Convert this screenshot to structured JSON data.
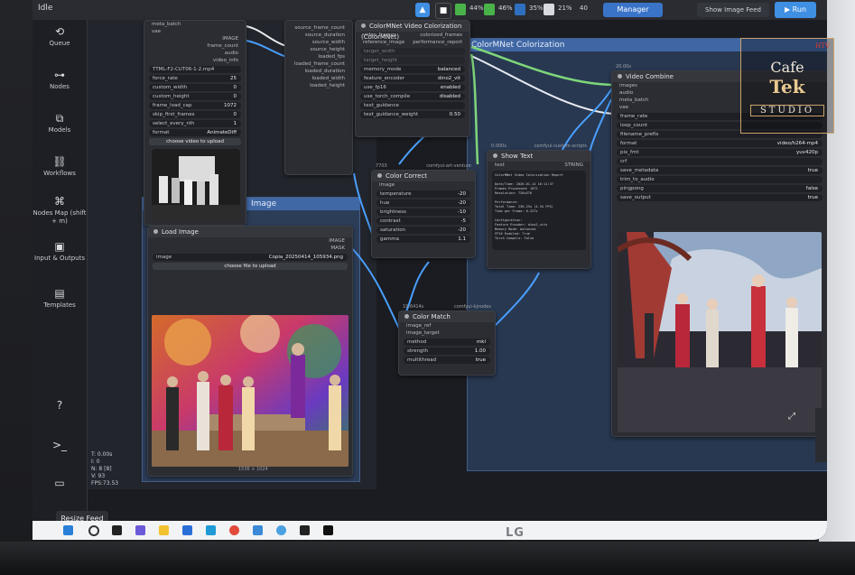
{
  "topbar": {
    "app_name": "Idle",
    "stats": [
      "44%",
      "46%",
      "35%",
      "21%",
      "40"
    ],
    "manager_label": "Manager",
    "feed_label": "Show Image Feed",
    "run_label": "Run"
  },
  "sidebar": {
    "items": [
      {
        "label": "Queue",
        "icon": "history-icon"
      },
      {
        "label": "Nodes",
        "icon": "nodes-icon"
      },
      {
        "label": "Models",
        "icon": "cube-icon"
      },
      {
        "label": "Workflows",
        "icon": "workflow-icon"
      },
      {
        "label": "Nodes Map (shift + m)",
        "icon": "map-icon"
      },
      {
        "label": "Input & Outputs",
        "icon": "image-icon"
      },
      {
        "label": "Templates",
        "icon": "template-icon"
      }
    ],
    "bottom_icons": [
      "help-icon",
      "terminal-icon",
      "keyboard-icon"
    ]
  },
  "groups": {
    "colorization": "ColorMNet Colorization",
    "image": "Image"
  },
  "nodes": {
    "video_loader": {
      "outputs": [
        "meta_batch",
        "vae"
      ],
      "outputs_right": [
        "IMAGE",
        "frame_count",
        "audio",
        "video_info"
      ],
      "widgets": [
        {
          "name": "TTML-F2-CUT06-1-2.mp4",
          "value": ""
        },
        {
          "name": "force_rate",
          "value": "25"
        },
        {
          "name": "custom_width",
          "value": "0"
        },
        {
          "name": "custom_height",
          "value": "0"
        },
        {
          "name": "frame_load_cap",
          "value": "1072"
        },
        {
          "name": "skip_first_frames",
          "value": "0"
        },
        {
          "name": "select_every_nth",
          "value": "1"
        },
        {
          "name": "format",
          "value": "AnimateDiff"
        }
      ],
      "upload_label": "choose video to upload"
    },
    "video_info": {
      "outputs": [
        "source_frame_count",
        "source_duration",
        "source_width",
        "source_height",
        "loaded_fps",
        "loaded_frame_count",
        "loaded_duration",
        "loaded_width",
        "loaded_height"
      ]
    },
    "colormnet": {
      "title": "ColorMNet Video Colorization (ColorMNet)",
      "inputs": [
        "video_frames",
        "reference_image"
      ],
      "outputs": [
        "colorized_frames",
        "performance_report"
      ],
      "widgets": [
        {
          "name": "target_width",
          "value": ""
        },
        {
          "name": "target_height",
          "value": ""
        },
        {
          "name": "memory_mode",
          "value": "balanced"
        },
        {
          "name": "feature_encoder",
          "value": "dino2_vit"
        },
        {
          "name": "use_fp16",
          "value": "enabled"
        },
        {
          "name": "use_torch_compile",
          "value": "disabled"
        },
        {
          "name": "text_guidance",
          "value": ""
        },
        {
          "name": "text_guidance_weight",
          "value": "0.50"
        }
      ]
    },
    "color_correct": {
      "id": "7703",
      "title": "Color Correct",
      "badge": "comfyui-art-venture",
      "inputs": [
        "image"
      ],
      "widgets": [
        {
          "name": "temperature",
          "value": "-20"
        },
        {
          "name": "hue",
          "value": "-20"
        },
        {
          "name": "brightness",
          "value": "-10"
        },
        {
          "name": "contrast",
          "value": "-5"
        },
        {
          "name": "saturation",
          "value": "-20"
        },
        {
          "name": "gamma",
          "value": "1.1"
        }
      ]
    },
    "color_match": {
      "id": "19.6414s",
      "title": "Color Match",
      "badge": "comfyui-kjnodes",
      "inputs": [
        "image_ref",
        "image_target"
      ],
      "widgets": [
        {
          "name": "method",
          "value": "mkl"
        },
        {
          "name": "strength",
          "value": "1.00"
        },
        {
          "name": "multithread",
          "value": "true"
        }
      ]
    },
    "show_text": {
      "id": "0.000s",
      "title": "Show Text",
      "badge": "comfyui-custom-scripts",
      "inputs": [
        "text"
      ],
      "outputs": [
        "STRING"
      ],
      "report": [
        "ColorMNet Video Colorization Report",
        "",
        "Date/Time: 2026-01-14 16:11:37",
        "Frames Processed: 1072",
        "Resolution: 720x576",
        "",
        "Performance:",
        "  Total Time: 236.23s (4.34 FPS)",
        "  Time per Frame: 0.227s",
        "",
        "Configuration:",
        "  Feature Encoder: dino2_vits",
        "  Memory Mode: balanced",
        "  FP16 Enabled: True",
        "  Torch Compile: False"
      ]
    },
    "video_combine": {
      "id": "20.00s",
      "title": "Video Combine",
      "inputs": [
        "images",
        "audio",
        "meta_batch",
        "vae"
      ],
      "widgets": [
        {
          "name": "frame_rate",
          "value": ""
        },
        {
          "name": "loop_count",
          "value": ""
        },
        {
          "name": "filename_prefix",
          "value": ""
        },
        {
          "name": "format",
          "value": "video/h264-mp4"
        },
        {
          "name": "pix_fmt",
          "value": "yuv420p"
        },
        {
          "name": "crf",
          "value": ""
        },
        {
          "name": "save_metadata",
          "value": "true"
        },
        {
          "name": "trim_to_audio",
          "value": ""
        },
        {
          "name": "pingpong",
          "value": "false"
        },
        {
          "name": "save_output",
          "value": "true"
        }
      ]
    },
    "load_image": {
      "title": "Load Image",
      "outputs": [
        "IMAGE",
        "MASK"
      ],
      "widgets": [
        {
          "name": "image",
          "value": "Copia_20250414_105934.png"
        }
      ],
      "upload_label": "choose file to upload",
      "dimensions": "1536 × 1024"
    }
  },
  "canvas_info": [
    "T: 0.00s",
    "I: 0",
    "N: 8 [8]",
    "V: 93",
    "FPS:73.53"
  ],
  "resize_feed_label": "Resize Feed",
  "logo": {
    "line1": "Cafe",
    "line2": "Tek",
    "line3": "STUDIO",
    "corner": "HTV"
  },
  "monitor_brand": "LG",
  "colors": {
    "group_blue": "#3a5a8c",
    "wire_blue": "#4a9fff",
    "wire_green": "#7ed67a",
    "wire_white": "#e8ecf0",
    "logo_gold": "#c9a26a"
  }
}
